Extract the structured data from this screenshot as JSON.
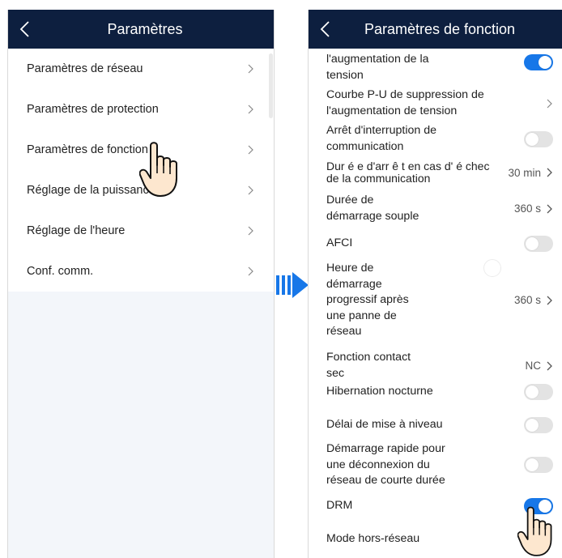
{
  "left_screen": {
    "title": "Paramètres",
    "items": [
      {
        "label": "Paramètres de réseau"
      },
      {
        "label": "Paramètres de protection"
      },
      {
        "label": "Paramètres de fonction"
      },
      {
        "label": "Réglage de la puissance"
      },
      {
        "label": "Réglage de l'heure"
      },
      {
        "label": "Conf. comm."
      }
    ]
  },
  "right_screen": {
    "title": "Paramètres de fonction",
    "rows": [
      {
        "label_lines": [
          "l'augmentation de la",
          "tension"
        ],
        "control": "toggle",
        "state": "on"
      },
      {
        "label_lines": [
          "Courbe P-U de suppression de",
          "l'augmentation de tension"
        ],
        "control": "chevron"
      },
      {
        "label_lines": [
          "Arrêt d'interruption de",
          "communication"
        ],
        "control": "toggle",
        "state": "off"
      },
      {
        "label_lines": [
          "Dur é e d'arr ê t en cas d' é chec",
          "de la communication"
        ],
        "value": "30 min",
        "control": "chevron"
      },
      {
        "label_lines": [
          "Durée de",
          "démarrage souple"
        ],
        "value": "360 s",
        "control": "chevron"
      },
      {
        "label_lines": [
          "AFCI"
        ],
        "control": "toggle",
        "state": "off"
      },
      {
        "label_lines": [
          "Heure de",
          "démarrage",
          "progressif après",
          "une panne de",
          "réseau"
        ],
        "value": "360 s",
        "control": "chevron"
      },
      {
        "label_lines": [
          "Fonction contact",
          "sec"
        ],
        "value": "NC",
        "control": "chevron"
      },
      {
        "label_lines": [
          "Hibernation nocturne"
        ],
        "control": "toggle",
        "state": "off"
      },
      {
        "label_lines": [
          "Délai de mise à niveau"
        ],
        "control": "toggle",
        "state": "off"
      },
      {
        "label_lines": [
          "Démarrage rapide pour",
          "une déconnexion du",
          "réseau de courte durée"
        ],
        "control": "toggle",
        "state": "off"
      },
      {
        "label_lines": [
          "DRM"
        ],
        "control": "toggle",
        "state": "on"
      },
      {
        "label_lines": [
          "Mode hors-réseau"
        ],
        "control": "none"
      }
    ]
  },
  "icons": {
    "back": "chevron-left-icon",
    "row_chevron": "chevron-right-icon",
    "transition": "double-arrow-right-icon",
    "pointer": "pointing-hand-icon"
  },
  "colors": {
    "header_bg": "#0d1f3f",
    "toggle_on": "#1777e8",
    "toggle_off": "#e3e3e3",
    "arrow": "#1777e8",
    "hand_fill": "#fde7cf"
  }
}
